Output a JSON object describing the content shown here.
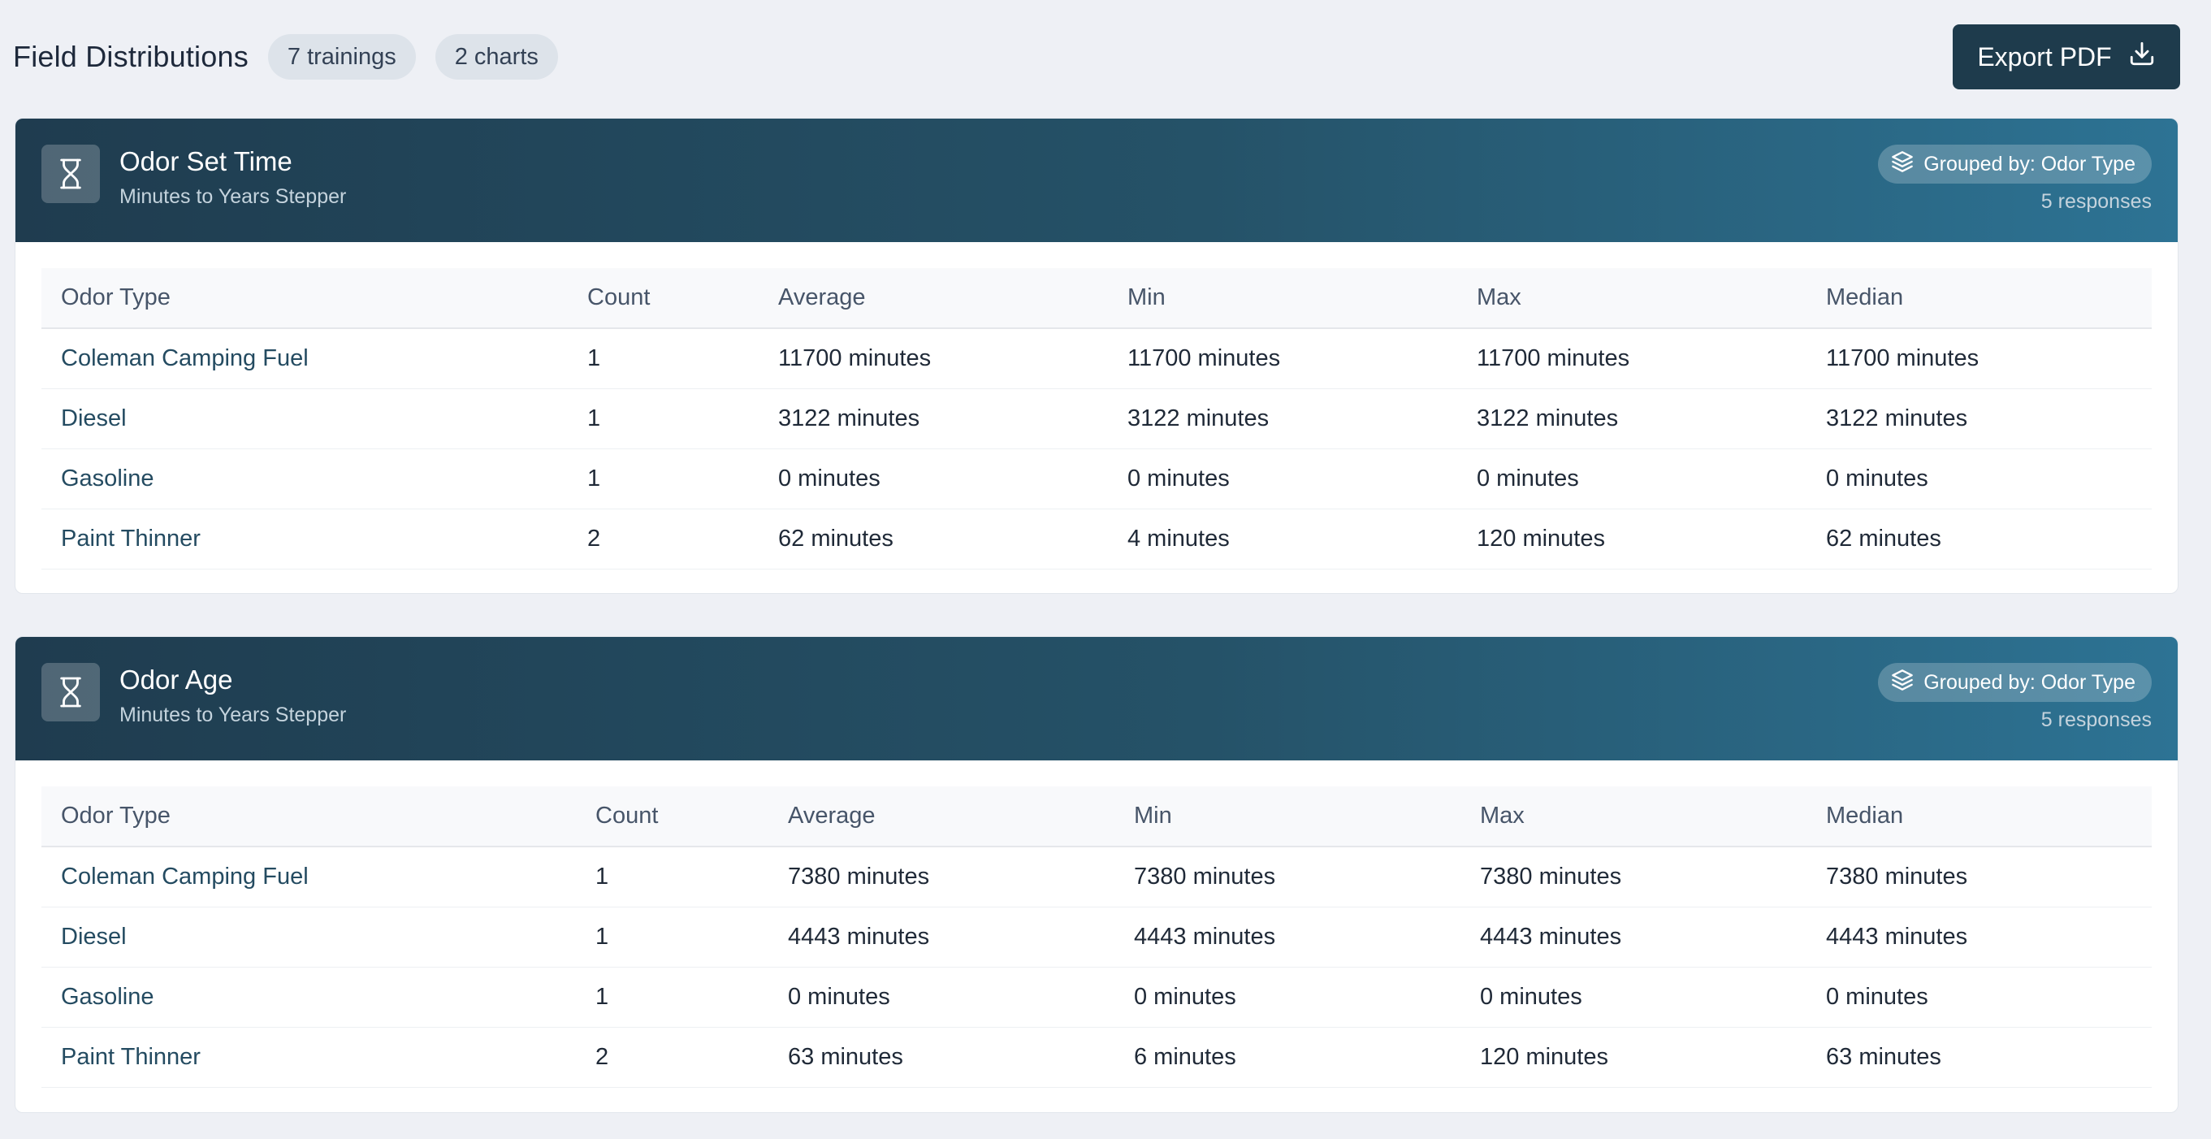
{
  "header": {
    "title": "Field Distributions",
    "trainings_badge": "7 trainings",
    "charts_badge": "2 charts",
    "export_label": "Export PDF"
  },
  "colors": {
    "page_bg": "#eef0f5",
    "accent_dark": "#1e3b4c",
    "header_gradient_start": "#1f3c4f",
    "header_gradient_end": "#2d7394",
    "group_text": "#244b61"
  },
  "cards": [
    {
      "icon": "hourglass-icon",
      "title": "Odor Set Time",
      "subtitle": "Minutes to Years Stepper",
      "grouped_by": "Grouped by: Odor Type",
      "responses": "5 responses",
      "columns": [
        "Odor Type",
        "Count",
        "Average",
        "Min",
        "Max",
        "Median"
      ],
      "rows": [
        [
          "Coleman Camping Fuel",
          "1",
          "11700 minutes",
          "11700 minutes",
          "11700 minutes",
          "11700 minutes"
        ],
        [
          "Diesel",
          "1",
          "3122 minutes",
          "3122 minutes",
          "3122 minutes",
          "3122 minutes"
        ],
        [
          "Gasoline",
          "1",
          "0 minutes",
          "0 minutes",
          "0 minutes",
          "0 minutes"
        ],
        [
          "Paint Thinner",
          "2",
          "62 minutes",
          "4 minutes",
          "120 minutes",
          "62 minutes"
        ]
      ]
    },
    {
      "icon": "hourglass-icon",
      "title": "Odor Age",
      "subtitle": "Minutes to Years Stepper",
      "grouped_by": "Grouped by: Odor Type",
      "responses": "5 responses",
      "columns": [
        "Odor Type",
        "Count",
        "Average",
        "Min",
        "Max",
        "Median"
      ],
      "rows": [
        [
          "Coleman Camping Fuel",
          "1",
          "7380 minutes",
          "7380 minutes",
          "7380 minutes",
          "7380 minutes"
        ],
        [
          "Diesel",
          "1",
          "4443 minutes",
          "4443 minutes",
          "4443 minutes",
          "4443 minutes"
        ],
        [
          "Gasoline",
          "1",
          "0 minutes",
          "0 minutes",
          "0 minutes",
          "0 minutes"
        ],
        [
          "Paint Thinner",
          "2",
          "63 minutes",
          "6 minutes",
          "120 minutes",
          "63 minutes"
        ]
      ]
    }
  ]
}
